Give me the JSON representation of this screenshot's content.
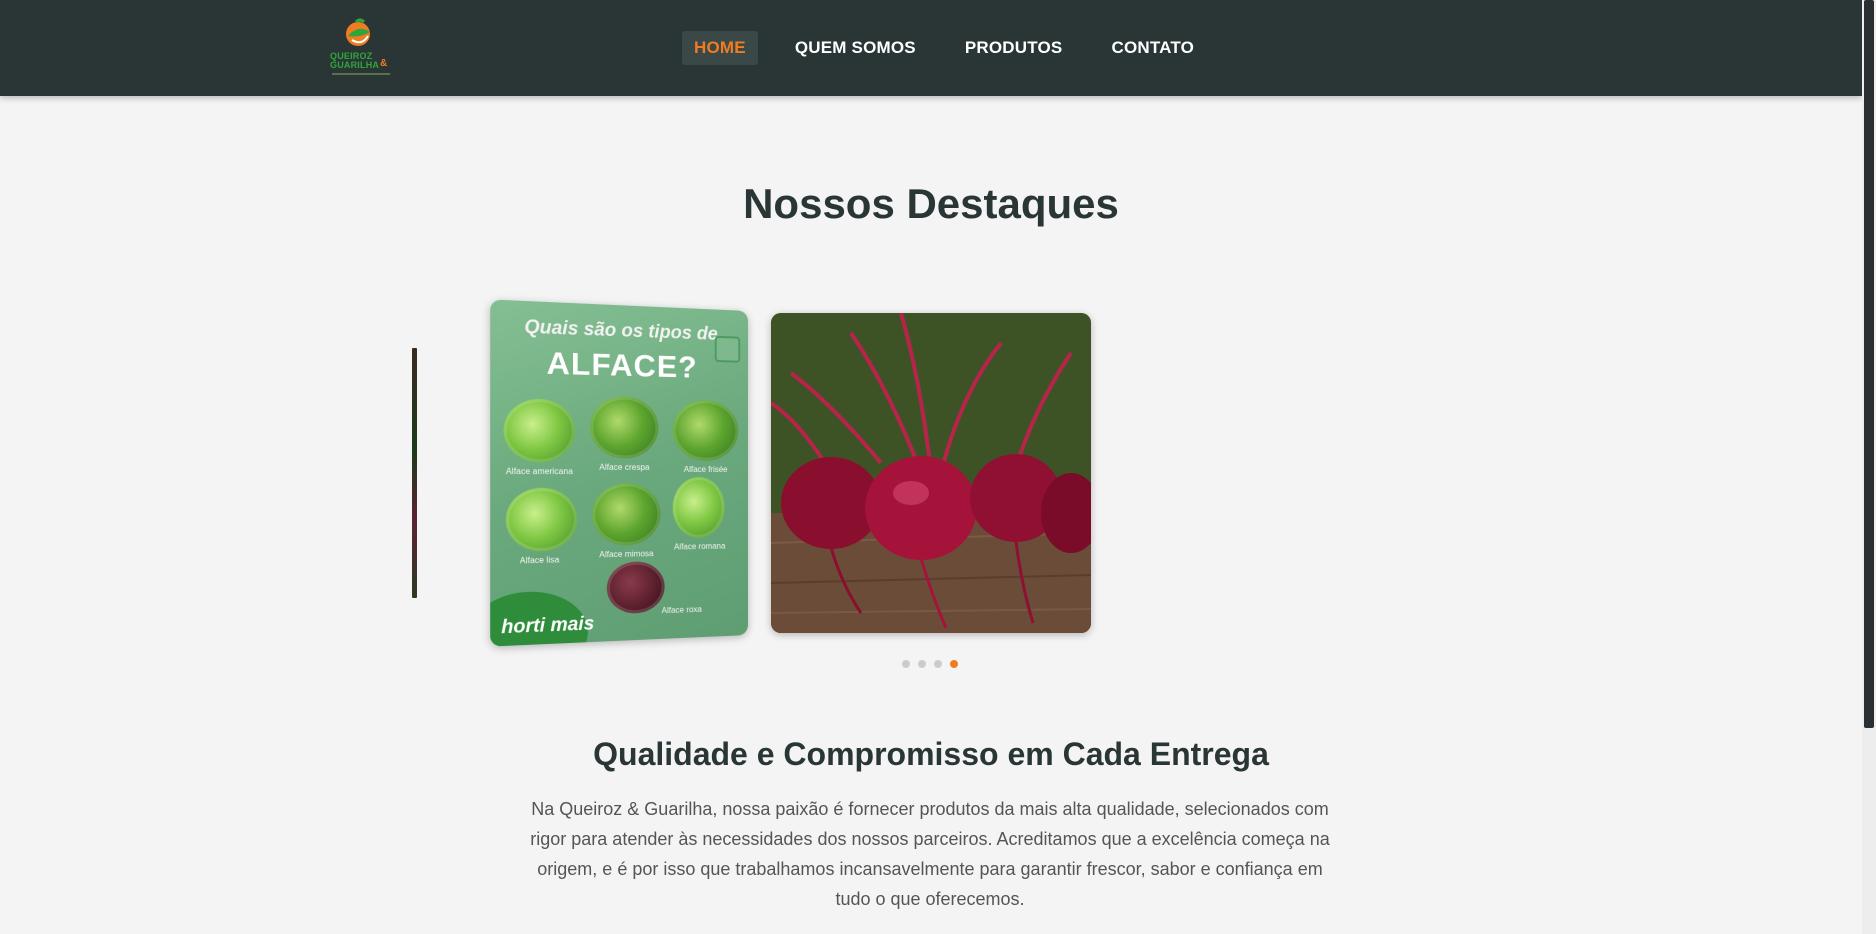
{
  "brand": {
    "logo_line1": "QUEIROZ",
    "logo_amp": "&",
    "logo_line2": "GUARILHA"
  },
  "nav": {
    "items": [
      {
        "label": "HOME",
        "active": true
      },
      {
        "label": "QUEM SOMOS",
        "active": false
      },
      {
        "label": "PRODUTOS",
        "active": false
      },
      {
        "label": "CONTATO",
        "active": false
      }
    ]
  },
  "highlights": {
    "title": "Nossos Destaques",
    "slides": [
      {
        "question": "Quais são os tipos de",
        "heading": "ALFACE?",
        "varieties": [
          "Alface americana",
          "Alface crespa",
          "Alface frisée",
          "Alface lisa",
          "Alface mimosa",
          "Alface romana",
          "Alface roxa"
        ],
        "badge": "horti mais"
      },
      {
        "subject": "beets"
      }
    ],
    "dots": {
      "count": 4,
      "active_index": 3
    }
  },
  "quality": {
    "title": "Qualidade e Compromisso em Cada Entrega",
    "text": "Na Queiroz & Guarilha, nossa paixão é fornecer produtos da mais alta qualidade, selecionados com rigor para atender às necessidades dos nossos parceiros. Acreditamos que a excelência começa na origem, e é por isso que trabalhamos incansavelmente para garantir frescor, sabor e confiança em tudo o que oferecemos."
  },
  "colors": {
    "header_bg": "#2a3636",
    "accent": "#f07c22",
    "page_bg": "#f4f4f4"
  }
}
